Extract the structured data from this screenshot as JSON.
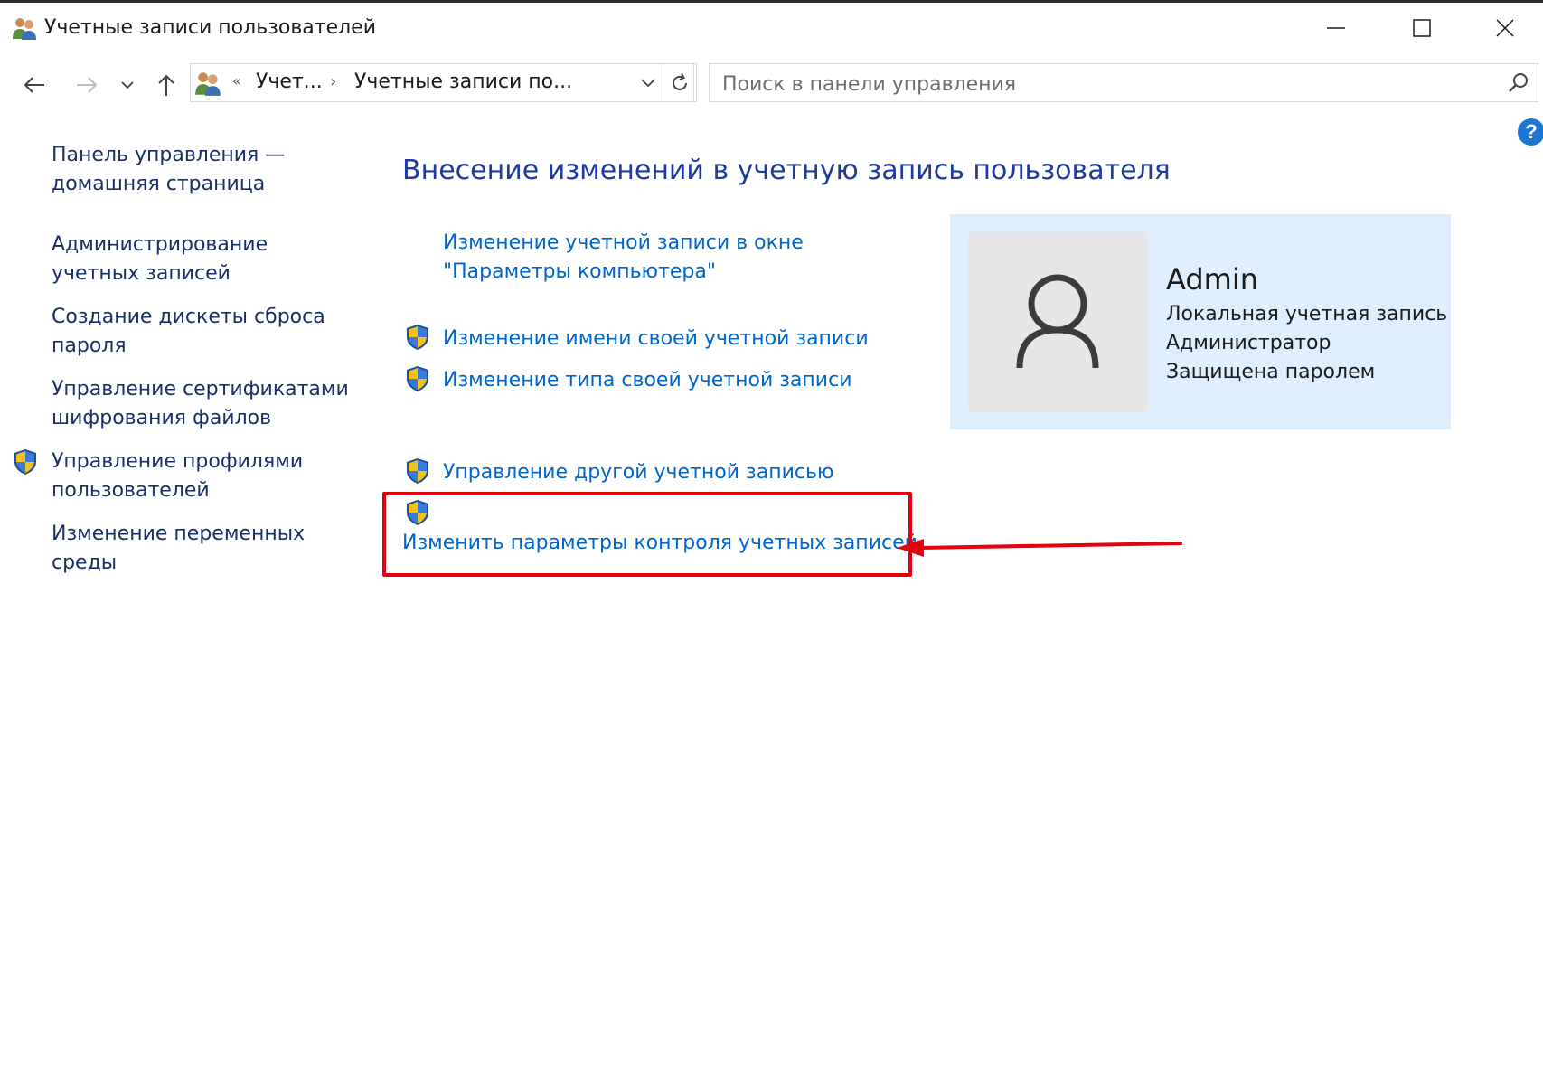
{
  "window": {
    "title": "Учетные записи пользователей",
    "icon": "users-icon"
  },
  "title_buttons": {
    "minimize_icon": "minimize-icon",
    "maximize_icon": "maximize-icon",
    "close_icon": "close-icon"
  },
  "nav": {
    "back_icon": "arrow-left-icon",
    "forward_icon": "arrow-right-icon",
    "recent_icon": "chevron-down-icon",
    "up_icon": "arrow-up-icon"
  },
  "address_bar": {
    "icon": "users-icon",
    "overflow": "«",
    "segments": [
      "Учет...",
      "Учетные записи по..."
    ],
    "separator": "›"
  },
  "search": {
    "placeholder": "Поиск в панели управления"
  },
  "help": {
    "label": "?"
  },
  "sidebar": {
    "items": [
      {
        "label": "Панель управления — домашняя страница",
        "shield": false
      },
      {
        "label": "Администрирование учетных записей",
        "shield": false
      },
      {
        "label": "Создание дискеты сброса пароля",
        "shield": false
      },
      {
        "label": "Управление сертификатами шифрования файлов",
        "shield": false
      },
      {
        "label": "Управление профилями пользователей",
        "shield": true
      },
      {
        "label": "Изменение переменных среды",
        "shield": false
      }
    ]
  },
  "main": {
    "heading": "Внесение изменений в учетную запись пользователя",
    "links": [
      {
        "label": "Изменение учетной записи в окне \"Параметры компьютера\"",
        "shield": false
      },
      {
        "label": "Изменение имени своей учетной записи",
        "shield": true
      },
      {
        "label": "Изменение типа своей учетной записи",
        "shield": true
      },
      {
        "label": "Управление другой учетной записью",
        "shield": true
      },
      {
        "label": "Изменить параметры контроля учетных записей",
        "shield": true
      }
    ]
  },
  "user_card": {
    "name": "Admin",
    "lines": [
      "Локальная учетная запись",
      "Администратор",
      "Защищена паролем"
    ],
    "avatar_icon": "user-avatar-icon",
    "background": "#dfeefc"
  },
  "colors": {
    "link": "#0066cc",
    "heading": "#1f3a9c",
    "sidebar_link": "#1a2f66",
    "annotation": "#e4000f"
  }
}
